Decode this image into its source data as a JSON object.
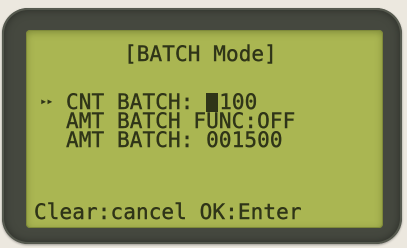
{
  "screen": {
    "title": "[BATCH Mode]",
    "selection_marker": "▸▸",
    "rows": [
      {
        "label": "CNT BATCH: ",
        "cursor_char": "",
        "value": "100",
        "selected": true
      },
      {
        "label": "AMT BATCH FUNC:OFF",
        "value": "",
        "selected": false
      },
      {
        "label": "AMT BATCH: 001500",
        "value": "",
        "selected": false
      }
    ],
    "footer": "Clear:cancel OK:Enter"
  },
  "colors": {
    "lcd_background": "#aab652",
    "lcd_text": "#2f3418",
    "bezel": "#45483f"
  }
}
